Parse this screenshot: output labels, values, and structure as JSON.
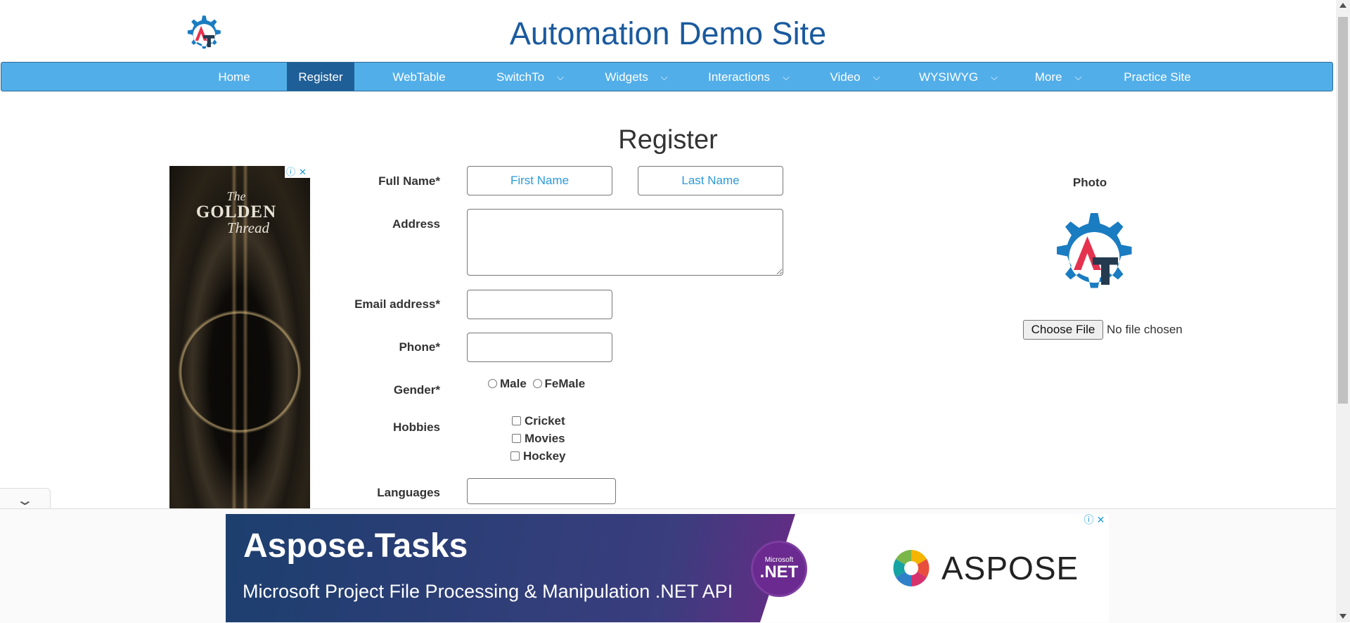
{
  "header": {
    "site_title": "Automation Demo Site",
    "logo_letters": "AT"
  },
  "nav": {
    "items": [
      {
        "label": "Home",
        "has_dropdown": false,
        "active": false
      },
      {
        "label": "Register",
        "has_dropdown": false,
        "active": true
      },
      {
        "label": "WebTable",
        "has_dropdown": false,
        "active": false
      },
      {
        "label": "SwitchTo",
        "has_dropdown": true,
        "active": false
      },
      {
        "label": "Widgets",
        "has_dropdown": true,
        "active": false
      },
      {
        "label": "Interactions",
        "has_dropdown": true,
        "active": false
      },
      {
        "label": "Video",
        "has_dropdown": true,
        "active": false
      },
      {
        "label": "WYSIWYG",
        "has_dropdown": true,
        "active": false
      },
      {
        "label": "More",
        "has_dropdown": true,
        "active": false
      },
      {
        "label": "Practice Site",
        "has_dropdown": false,
        "active": false
      }
    ],
    "chevron": "⌵"
  },
  "page": {
    "heading": "Register"
  },
  "form": {
    "full_name_label": "Full Name*",
    "first_name_placeholder": "First Name",
    "last_name_placeholder": "Last Name",
    "first_name_value": "",
    "last_name_value": "",
    "address_label": "Address",
    "address_value": "",
    "email_label": "Email address*",
    "email_value": "",
    "phone_label": "Phone*",
    "phone_value": "",
    "gender_label": "Gender*",
    "gender_options": [
      "Male",
      "FeMale"
    ],
    "hobbies_label": "Hobbies",
    "hobbies": [
      "Cricket",
      "Movies",
      "Hockey"
    ],
    "languages_label": "Languages",
    "languages_value": ""
  },
  "photo": {
    "label": "Photo",
    "choose_file": "Choose File",
    "file_status": "No file chosen"
  },
  "side_ad": {
    "line1": "The",
    "line2": "GOLDEN",
    "line3": "Thread",
    "info_icon": "ⓘ",
    "close_icon": "✕"
  },
  "bottom_ad": {
    "title": "Aspose.Tasks",
    "subtitle": "Microsoft Project File Processing & Manipulation .NET API",
    "badge_top": "Microsoft",
    "badge_main": ".NET",
    "brand": "ASPOSE",
    "info_icon": "ⓘ",
    "close_icon": "✕"
  },
  "overlay": {
    "collapse_icon": "⌄"
  },
  "colors": {
    "nav_bg": "#52aee8",
    "nav_active": "#1f5f97",
    "title_blue": "#1a5a9e",
    "placeholder_blue": "#2a9ad8",
    "logo_gear": "#1a7cc1",
    "logo_red": "#e4324f",
    "logo_dark": "#243a4e"
  }
}
